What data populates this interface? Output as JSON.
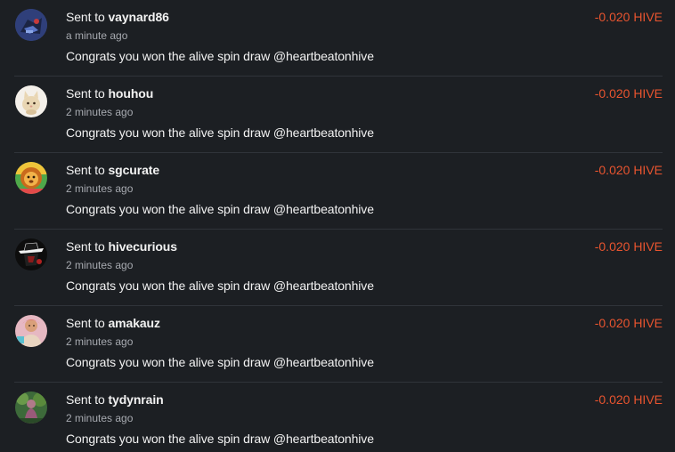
{
  "sent_prefix": "Sent to",
  "colors": {
    "background": "#1c1f23",
    "text": "#f2f2f2",
    "muted": "#a7aab0",
    "amount": "#e8542f",
    "divider": "#30343a"
  },
  "transactions": [
    {
      "recipient": "vaynard86",
      "time": "a minute ago",
      "memo": "Congrats you won the alive spin draw @heartbeatonhive",
      "amount": "-0.020 HIVE",
      "avatar_icon": "robot-avatar-icon"
    },
    {
      "recipient": "houhou",
      "time": "2 minutes ago",
      "memo": "Congrats you won the alive spin draw @heartbeatonhive",
      "amount": "-0.020 HIVE",
      "avatar_icon": "cat-avatar-icon"
    },
    {
      "recipient": "sgcurate",
      "time": "2 minutes ago",
      "memo": "Congrats you won the alive spin draw @heartbeatonhive",
      "amount": "-0.020 HIVE",
      "avatar_icon": "lion-avatar-icon"
    },
    {
      "recipient": "hivecurious",
      "time": "2 minutes ago",
      "memo": "Congrats you won the alive spin draw @heartbeatonhive",
      "amount": "-0.020 HIVE",
      "avatar_icon": "hat-figure-avatar-icon"
    },
    {
      "recipient": "amakauz",
      "time": "2 minutes ago",
      "memo": "Congrats you won the alive spin draw @heartbeatonhive",
      "amount": "-0.020 HIVE",
      "avatar_icon": "person-avatar-icon"
    },
    {
      "recipient": "tydynrain",
      "time": "2 minutes ago",
      "memo": "Congrats you won the alive spin draw @heartbeatonhive",
      "amount": "-0.020 HIVE",
      "avatar_icon": "forest-figure-avatar-icon"
    }
  ]
}
